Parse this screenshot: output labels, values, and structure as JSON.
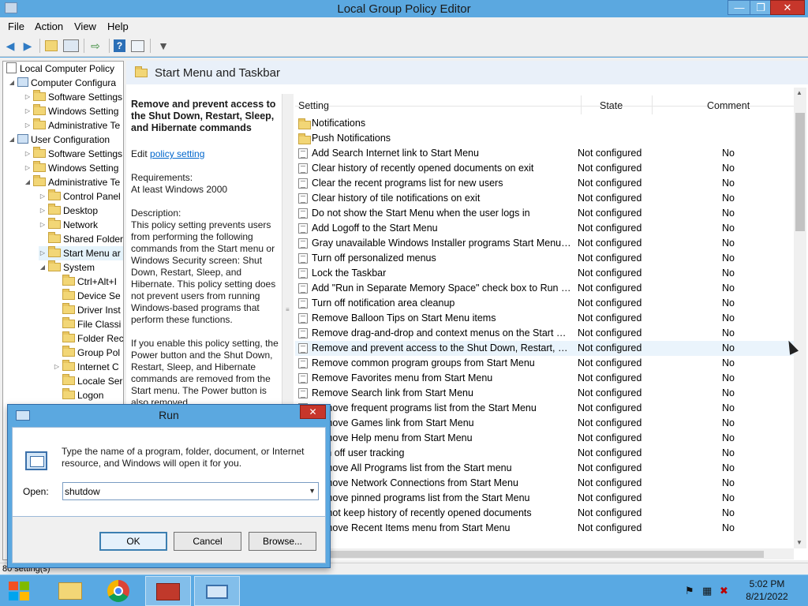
{
  "window": {
    "title": "Local Group Policy Editor",
    "minimize": "—",
    "maximize": "❐",
    "close": "✕"
  },
  "menu": [
    "File",
    "Action",
    "View",
    "Help"
  ],
  "toolbar_icons": [
    "back-icon",
    "forward-icon",
    "up-folder-icon",
    "show-hide-tree-icon",
    "export-list-icon",
    "help-icon",
    "properties-icon",
    "filter-icon"
  ],
  "tree": {
    "root": "Local Computer Policy",
    "computer_config": "Computer Configura",
    "cc_software": "Software Settings",
    "cc_windows": "Windows Setting",
    "cc_admin": "Administrative Te",
    "user_config": "User Configuration",
    "uc_software": "Software Settings",
    "uc_windows": "Windows Setting",
    "uc_admin": "Administrative Te",
    "control_panel": "Control Panel",
    "desktop": "Desktop",
    "network": "Network",
    "shared_folders": "Shared Folder",
    "start_menu": "Start Menu ar",
    "system": "System",
    "ctrl_alt": "Ctrl+Alt+I",
    "device_settings": "Device Se",
    "driver_install": "Driver Inst",
    "file_classification": "File Classi",
    "folder_redirection": "Folder Rec",
    "group_policy": "Group Pol",
    "internet_comm": "Internet C",
    "locale_services": "Locale Ser",
    "logon": "Logon"
  },
  "pane": {
    "header_title": "Start Menu and Taskbar",
    "policy_title": "Remove and prevent access to the Shut Down, Restart, Sleep, and Hibernate commands",
    "edit_prefix": "Edit",
    "edit_link": "policy setting",
    "requirements_label": "Requirements:",
    "requirements_value": "At least Windows 2000",
    "description_label": "Description:",
    "description_text": "This policy setting prevents users from performing the following commands from the Start menu or Windows Security screen: Shut Down, Restart, Sleep, and Hibernate. This policy setting does not prevent users from running Windows-based programs that perform these functions.",
    "description_text2": "If you enable this policy setting, the Power button and the Shut Down, Restart, Sleep, and Hibernate commands are removed from the Start menu. The Power button is also removed"
  },
  "list": {
    "headers": {
      "setting": "Setting",
      "state": "State",
      "comment": "Comment"
    },
    "rows": [
      {
        "setting": "Notifications",
        "state": "",
        "comment": "",
        "type": "folder"
      },
      {
        "setting": "Push Notifications",
        "state": "",
        "comment": "",
        "type": "folder"
      },
      {
        "setting": "Add Search Internet link to Start Menu",
        "state": "Not configured",
        "comment": "No",
        "type": "policy"
      },
      {
        "setting": "Clear history of recently opened documents on exit",
        "state": "Not configured",
        "comment": "No",
        "type": "policy"
      },
      {
        "setting": "Clear the recent programs list for new users",
        "state": "Not configured",
        "comment": "No",
        "type": "policy"
      },
      {
        "setting": "Clear history of tile notifications on exit",
        "state": "Not configured",
        "comment": "No",
        "type": "policy"
      },
      {
        "setting": "Do not show the Start Menu when the user logs in",
        "state": "Not configured",
        "comment": "No",
        "type": "policy"
      },
      {
        "setting": "Add Logoff to the Start Menu",
        "state": "Not configured",
        "comment": "No",
        "type": "policy"
      },
      {
        "setting": "Gray unavailable Windows Installer programs Start Menu sh...",
        "state": "Not configured",
        "comment": "No",
        "type": "policy"
      },
      {
        "setting": "Turn off personalized menus",
        "state": "Not configured",
        "comment": "No",
        "type": "policy"
      },
      {
        "setting": "Lock the Taskbar",
        "state": "Not configured",
        "comment": "No",
        "type": "policy"
      },
      {
        "setting": "Add \"Run in Separate Memory Space\" check box to Run dial...",
        "state": "Not configured",
        "comment": "No",
        "type": "policy"
      },
      {
        "setting": "Turn off notification area cleanup",
        "state": "Not configured",
        "comment": "No",
        "type": "policy"
      },
      {
        "setting": "Remove Balloon Tips on Start Menu items",
        "state": "Not configured",
        "comment": "No",
        "type": "policy"
      },
      {
        "setting": "Remove drag-and-drop and context menus on the Start Me...",
        "state": "Not configured",
        "comment": "No",
        "type": "policy"
      },
      {
        "setting": "Remove and prevent access to the Shut Down, Restart, Sleep...",
        "state": "Not configured",
        "comment": "No",
        "type": "policy"
      },
      {
        "setting": "Remove common program groups from Start Menu",
        "state": "Not configured",
        "comment": "No",
        "type": "policy"
      },
      {
        "setting": "Remove Favorites menu from Start Menu",
        "state": "Not configured",
        "comment": "No",
        "type": "policy"
      },
      {
        "setting": "Remove Search link from Start Menu",
        "state": "Not configured",
        "comment": "No",
        "type": "policy"
      },
      {
        "setting": "Remove frequent programs list from the Start Menu",
        "state": "Not configured",
        "comment": "No",
        "type": "policy"
      },
      {
        "setting": "Remove Games link from Start Menu",
        "state": "Not configured",
        "comment": "No",
        "type": "policy"
      },
      {
        "setting": "Remove Help menu from Start Menu",
        "state": "Not configured",
        "comment": "No",
        "type": "policy"
      },
      {
        "setting": "Turn off user tracking",
        "state": "Not configured",
        "comment": "No",
        "type": "policy"
      },
      {
        "setting": "Remove All Programs list from the Start menu",
        "state": "Not configured",
        "comment": "No",
        "type": "policy"
      },
      {
        "setting": "Remove Network Connections from Start Menu",
        "state": "Not configured",
        "comment": "No",
        "type": "policy"
      },
      {
        "setting": "Remove pinned programs list from the Start Menu",
        "state": "Not configured",
        "comment": "No",
        "type": "policy"
      },
      {
        "setting": "Do not keep history of recently opened documents",
        "state": "Not configured",
        "comment": "No",
        "type": "policy"
      },
      {
        "setting": "Remove Recent Items menu from Start Menu",
        "state": "Not configured",
        "comment": "No",
        "type": "policy"
      }
    ]
  },
  "statusbar": "80 setting(s)",
  "run_dialog": {
    "title": "Run",
    "close": "✕",
    "prompt": "Type the name of a program, folder, document, or Internet resource, and Windows will open it for you.",
    "open_label": "Open:",
    "open_value": "shutdow",
    "ok": "OK",
    "cancel": "Cancel",
    "browse": "Browse..."
  },
  "taskbar": {
    "apps": [
      "file-explorer-icon",
      "chrome-icon",
      "toolbox-icon",
      "run-dialog-icon"
    ],
    "time": "5:02 PM",
    "date": "8/21/2022"
  },
  "colors": {
    "titlebar": "#5ba8e0",
    "taskbar": "#59a9e3",
    "link": "#0066cc",
    "close": "#c7362b"
  }
}
